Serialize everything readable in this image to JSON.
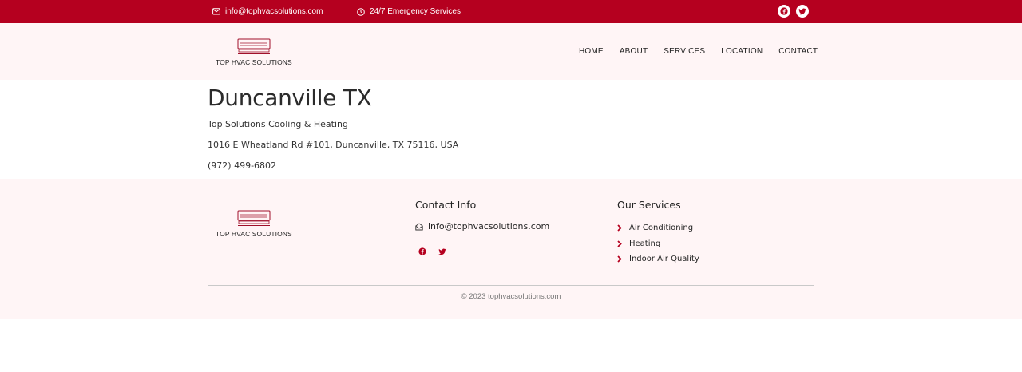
{
  "topbar": {
    "email": "info@tophvacsolutions.com",
    "emergency": "24/7 Emergency Services",
    "social_icons": [
      "facebook-icon",
      "twitter-icon"
    ],
    "bg_color": "#b5001f"
  },
  "header": {
    "logo_text": "TOP HVAC SOLUTIONS",
    "nav": [
      {
        "label": "HOME"
      },
      {
        "label": "ABOUT"
      },
      {
        "label": "SERVICES"
      },
      {
        "label": "LOCATION"
      },
      {
        "label": "CONTACT"
      }
    ]
  },
  "main": {
    "title": "Duncanville TX",
    "business_name": "Top Solutions Cooling & Heating",
    "address": "1016 E Wheatland Rd #101, Duncanville, TX 75116, USA",
    "phone": "(972) 499-6802"
  },
  "footer": {
    "logo_text": "TOP HVAC SOLUTIONS",
    "contact_heading": "Contact Info",
    "contact_email": "info@tophvacsolutions.com",
    "services_heading": "Our Services",
    "services": [
      {
        "label": "Air Conditioning"
      },
      {
        "label": "Heating"
      },
      {
        "label": "Indoor Air Quality"
      }
    ],
    "copyright": "© 2023 tophvacsolutions.com",
    "accent_color": "#b5001f"
  }
}
